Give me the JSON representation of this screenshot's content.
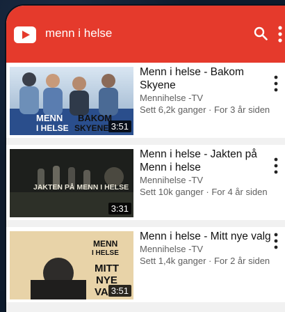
{
  "search": {
    "query": "menn i helse"
  },
  "icons": {
    "logo": "youtube-logo-icon",
    "search": "search-icon",
    "more": "more-vertical-icon"
  },
  "colors": {
    "appbar": "#e53a2c"
  },
  "videos": [
    {
      "title": "Menn i helse - Bakom Skyene",
      "channel": "Mennihelse -TV",
      "stats": "Sett 6,2k ganger · For 3 år siden",
      "duration": "3:51",
      "thumb_lines": [
        "MENN",
        "I HELSE",
        "BAKOM",
        "SKYENE"
      ]
    },
    {
      "title": "Menn i helse - Jakten på Menn i helse",
      "channel": "Mennihelse -TV",
      "stats": "Sett 10k ganger · For 4 år siden",
      "duration": "3:31",
      "thumb_lines": [
        "JAKTEN PÅ MENN I HELSE"
      ]
    },
    {
      "title": "Menn i helse - Mitt nye valg",
      "channel": "Mennihelse -TV",
      "stats": "Sett 1,4k ganger · For 2 år siden",
      "duration": "3:51",
      "thumb_lines": [
        "MENN",
        "I HELSE",
        "MITT",
        "NYE",
        "VA"
      ]
    }
  ]
}
